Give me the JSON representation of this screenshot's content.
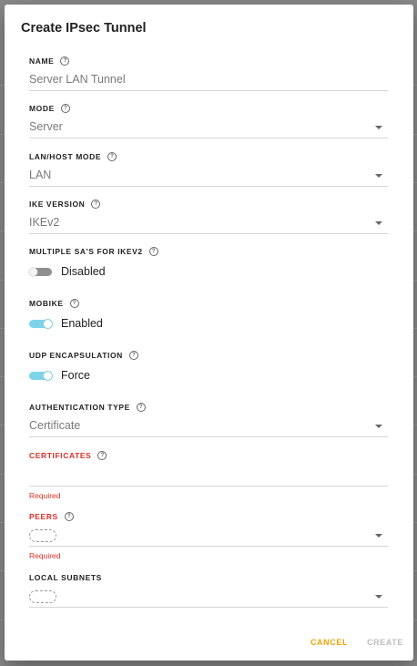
{
  "dialog": {
    "title": "Create IPsec Tunnel"
  },
  "fields": {
    "name": {
      "label": "NAME",
      "value": "Server LAN Tunnel"
    },
    "mode": {
      "label": "MODE",
      "value": "Server"
    },
    "lan_host_mode": {
      "label": "LAN/HOST MODE",
      "value": "LAN"
    },
    "ike_version": {
      "label": "IKE VERSION",
      "value": "IKEv2"
    },
    "multiple_sas": {
      "label": "MULTIPLE SA'S FOR IKEV2",
      "state": "Disabled",
      "on": false
    },
    "mobike": {
      "label": "MOBIKE",
      "state": "Enabled",
      "on": true
    },
    "udp_encapsulation": {
      "label": "UDP ENCAPSULATION",
      "state": "Force",
      "on": true
    },
    "authentication_type": {
      "label": "AUTHENTICATION TYPE",
      "value": "Certificate"
    },
    "certificates": {
      "label": "CERTIFICATES",
      "value": "",
      "error": "Required"
    },
    "peers": {
      "label": "PEERS",
      "error": "Required"
    },
    "local_subnets": {
      "label": "LOCAL SUBNETS"
    }
  },
  "actions": {
    "cancel": "CANCEL",
    "create": "CREATE"
  },
  "icons": {
    "help": "help-circle-icon",
    "dropdown": "chevron-down-icon"
  },
  "colors": {
    "toggle_on": "#7fd3e8",
    "error": "#d93025",
    "cancel_accent": "#f0a30a",
    "disabled": "#bdbdbd"
  }
}
